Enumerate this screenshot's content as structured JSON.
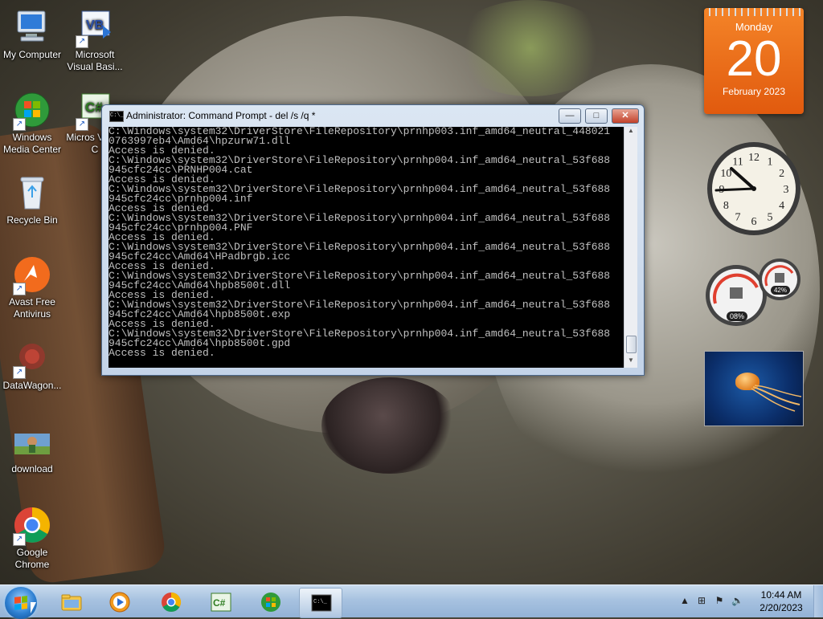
{
  "desktop": {
    "icons": [
      {
        "label": "My Computer"
      },
      {
        "label": "Microsoft Visual Basi..."
      },
      {
        "label": "Windows Media Center"
      },
      {
        "label": "Micros Visual C"
      },
      {
        "label": "Recycle Bin"
      },
      {
        "label": "Avast Free Antivirus"
      },
      {
        "label": "DataWagon..."
      },
      {
        "label": "download"
      },
      {
        "label": "Google Chrome"
      }
    ]
  },
  "cmd_window": {
    "title": "Administrator: Command Prompt - del  /s /q *",
    "icon_text": "C:\\_",
    "minimize": "—",
    "maximize": "□",
    "close": "✕",
    "lines": [
      "C:\\Windows\\system32\\DriverStore\\FileRepository\\prnhp003.inf_amd64_neutral_448021",
      "0763997eb4\\Amd64\\hpzurw71.dll",
      "Access is denied.",
      "C:\\Windows\\system32\\DriverStore\\FileRepository\\prnhp004.inf_amd64_neutral_53f688",
      "945cfc24cc\\PRNHP004.cat",
      "Access is denied.",
      "C:\\Windows\\system32\\DriverStore\\FileRepository\\prnhp004.inf_amd64_neutral_53f688",
      "945cfc24cc\\prnhp004.inf",
      "Access is denied.",
      "C:\\Windows\\system32\\DriverStore\\FileRepository\\prnhp004.inf_amd64_neutral_53f688",
      "945cfc24cc\\prnhp004.PNF",
      "Access is denied.",
      "C:\\Windows\\system32\\DriverStore\\FileRepository\\prnhp004.inf_amd64_neutral_53f688",
      "945cfc24cc\\Amd64\\HPadbrgb.icc",
      "Access is denied.",
      "C:\\Windows\\system32\\DriverStore\\FileRepository\\prnhp004.inf_amd64_neutral_53f688",
      "945cfc24cc\\Amd64\\hpb8500t.dll",
      "Access is denied.",
      "C:\\Windows\\system32\\DriverStore\\FileRepository\\prnhp004.inf_amd64_neutral_53f688",
      "945cfc24cc\\Amd64\\hpb8500t.exp",
      "Access is denied.",
      "C:\\Windows\\system32\\DriverStore\\FileRepository\\prnhp004.inf_amd64_neutral_53f688",
      "945cfc24cc\\Amd64\\hpb8500t.gpd",
      "Access is denied."
    ]
  },
  "gadgets": {
    "calendar": {
      "day_name": "Monday",
      "day_number": "20",
      "month_year": "February 2023"
    },
    "cpu_meter": {
      "cpu": "08%",
      "memory": "42%"
    },
    "clock_numbers": [
      "12",
      "1",
      "2",
      "3",
      "4",
      "5",
      "6",
      "7",
      "8",
      "9",
      "10",
      "11"
    ]
  },
  "taskbar": {
    "apps": [
      {
        "name": "windows-explorer"
      },
      {
        "name": "windows-media-player"
      },
      {
        "name": "google-chrome"
      },
      {
        "name": "visual-csharp"
      },
      {
        "name": "windows-media-center"
      },
      {
        "name": "command-prompt",
        "active": true
      }
    ],
    "clock": {
      "time": "10:44 AM",
      "date": "2/20/2023"
    }
  },
  "colors": {
    "accent_orange": "#e86a16",
    "console_bg": "#000000",
    "console_text": "#c0c0c0"
  }
}
